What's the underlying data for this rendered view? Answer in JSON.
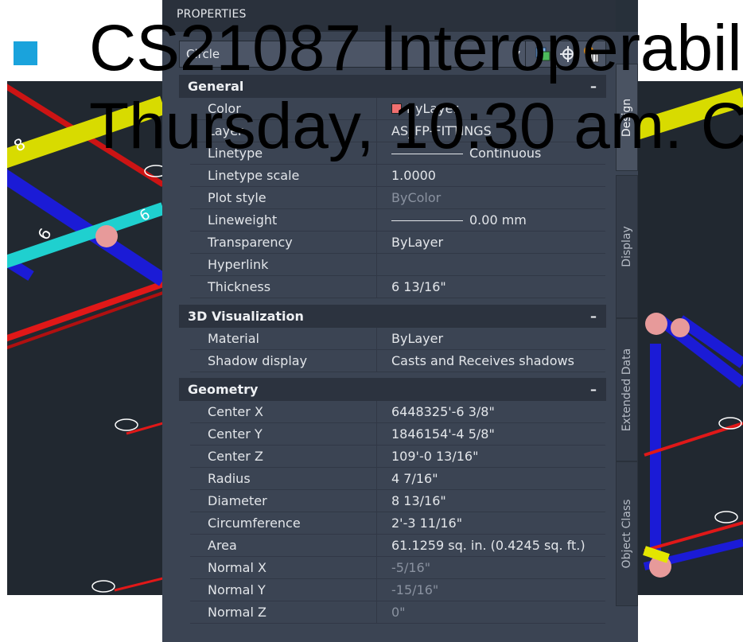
{
  "slide": {
    "title_line1": "CS21087 Interoperabil",
    "title_line2": "Thursday, 10:30 am. C",
    "accent_color": "#1aa3dc"
  },
  "palette": {
    "title": "PROPERTIES",
    "object_type": "Circle",
    "icons": [
      "quick-select-icon",
      "select-objects-icon",
      "toggle-pickadd-icon"
    ],
    "sections": [
      {
        "title": "General",
        "toggle": "–",
        "rows": [
          {
            "name": "Color",
            "value": "ByLayer",
            "swatch": "#f07070"
          },
          {
            "name": "Layer",
            "value": "AS_FP-FITTINGS"
          },
          {
            "name": "Linetype",
            "value": "Continuous",
            "line": true
          },
          {
            "name": "Linetype scale",
            "value": "1.0000"
          },
          {
            "name": "Plot style",
            "value": "ByColor",
            "dim": true
          },
          {
            "name": "Lineweight",
            "value": "0.00 mm",
            "line": true
          },
          {
            "name": "Transparency",
            "value": "ByLayer"
          },
          {
            "name": "Hyperlink",
            "value": ""
          },
          {
            "name": "Thickness",
            "value": "6 13/16\""
          }
        ]
      },
      {
        "title": "3D Visualization",
        "toggle": "–",
        "rows": [
          {
            "name": "Material",
            "value": "ByLayer"
          },
          {
            "name": "Shadow display",
            "value": "Casts and Receives shadows"
          }
        ]
      },
      {
        "title": "Geometry",
        "toggle": "–",
        "rows": [
          {
            "name": "Center X",
            "value": "6448325'-6 3/8\""
          },
          {
            "name": "Center Y",
            "value": "1846154'-4 5/8\""
          },
          {
            "name": "Center Z",
            "value": "109'-0 13/16\""
          },
          {
            "name": "Radius",
            "value": "4 7/16\""
          },
          {
            "name": "Diameter",
            "value": "8 13/16\""
          },
          {
            "name": "Circumference",
            "value": "2'-3 11/16\""
          },
          {
            "name": "Area",
            "value": "61.1259 sq. in. (0.4245 sq. ft.)"
          },
          {
            "name": "Normal X",
            "value": "-5/16\"",
            "dim": true
          },
          {
            "name": "Normal Y",
            "value": "-15/16\"",
            "dim": true
          },
          {
            "name": "Normal Z",
            "value": "0\"",
            "dim": true
          }
        ]
      }
    ],
    "side_tabs": [
      "Design",
      "Display",
      "Extended Data",
      "Object Class"
    ],
    "active_tab": "Design"
  },
  "viewport": {
    "left_labels": [
      "8",
      "6",
      "6"
    ],
    "pipe_colors": [
      "#e3e600",
      "#1b1bd6",
      "#1fd0cf",
      "#e01818",
      "#e79a9a"
    ]
  }
}
